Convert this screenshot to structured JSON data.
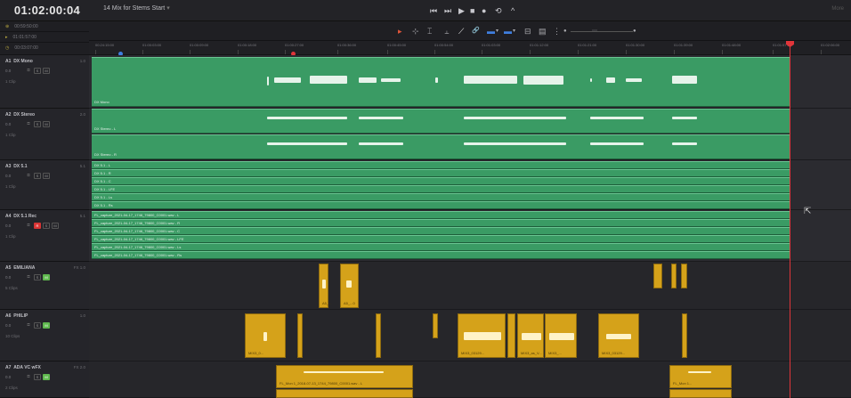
{
  "header": {
    "timecode": "01:02:00:04",
    "timeline_name": "14 Mix for Stems Start",
    "more_label": "More",
    "transport": [
      "⏮",
      "⏭",
      "▶",
      "■",
      "●",
      "⟲",
      "^"
    ],
    "info_rows": [
      {
        "glyph": "⊕",
        "value": "00:59:50:00"
      },
      {
        "glyph": "▸",
        "value": "01:01:57:00"
      },
      {
        "glyph": "◷",
        "value": "00:03:07:00"
      }
    ]
  },
  "toolbar": {
    "tools": [
      "▸",
      "⊹",
      "⌶",
      "⫠",
      "⟋",
      "🔗",
      "▬",
      "▾",
      "▬",
      "▾",
      "⊟",
      "▤",
      "⋮",
      "●",
      "⋯",
      "●"
    ]
  },
  "ruler": {
    "labels": [
      "00:24:15:00",
      "01:00:03:00",
      "01:00:09:00",
      "01:00:18:00",
      "01:00:27:00",
      "01:00:36:00",
      "01:00:45:00",
      "01:00:54:00",
      "01:01:03:00",
      "01:01:12:00",
      "01:01:21:00",
      "01:01:30:00",
      "01:01:39:00",
      "01:01:48:00",
      "01:01:57:00",
      "01:02:06:00"
    ]
  },
  "tracks": [
    {
      "id": "A1",
      "name": "DX Mono",
      "format": "1.0",
      "volume": "0.0",
      "clips": "1 Clip",
      "buttons": [
        "S",
        "M"
      ],
      "rec": false
    },
    {
      "id": "A2",
      "name": "DX Stereo",
      "format": "2.0",
      "volume": "0.0",
      "clips": "1 Clip",
      "buttons": [
        "S",
        "M"
      ],
      "rec": false
    },
    {
      "id": "A3",
      "name": "DX 5.1",
      "format": "5.1",
      "volume": "0.0",
      "clips": "1 Clip",
      "buttons": [
        "S",
        "M"
      ],
      "rec": false
    },
    {
      "id": "A4",
      "name": "DX 5.1 Rec",
      "format": "5.1",
      "volume": "0.0",
      "clips": "1 Clip",
      "buttons": [
        "R",
        "S",
        "M"
      ],
      "rec": true
    },
    {
      "id": "A5",
      "name": "EMILIANA",
      "format": "FX  1.0",
      "volume": "0.0",
      "clips": "5 Clips",
      "buttons": [
        "S",
        "M"
      ],
      "rec": false
    },
    {
      "id": "A6",
      "name": "PHILIP",
      "format": "1.0",
      "volume": "0.0",
      "clips": "10 Clips",
      "buttons": [
        "S",
        "M"
      ],
      "rec": false
    },
    {
      "id": "A7",
      "name": "ADA VC wFX",
      "format": "FX  2.0",
      "volume": "0.0",
      "clips": "2 Clips",
      "buttons": [
        "S",
        "M"
      ],
      "rec": false
    }
  ],
  "clip_labels": {
    "a1": "DX Mono",
    "a2_l": "DX Stereo - L",
    "a2_r": "DX Stereo - R",
    "a3": [
      "DX 5.1 - L",
      "DX 5.1 - R",
      "DX 5.1 - C",
      "DX 5.1 - LFE",
      "DX 5.1 - Ls",
      "DX 5.1 - Rs"
    ],
    "a4": [
      "FL_capture_2021-04-17_1746_79800_C0001.wav - L",
      "FL_capture_2021-04-17_1746_79800_C0001.wav - R",
      "FL_capture_2021-04-17_1746_79800_C0001.wav - C",
      "FL_capture_2021-04-17_1746_79800_C0001.wav - LFE",
      "FL_capture_2021-04-17_1746_79800_C0001.wav - Ls",
      "FL_capture_2021-04-17_1746_79800_C0001.wav - Rs"
    ],
    "a5": [
      "A5_...",
      "A5_...0"
    ],
    "a6": [
      "MIX3_0...",
      "MIX3_03129...",
      "MIX3_as_V...",
      "MIX3_...",
      "MIX3_03129..."
    ],
    "a7": [
      "FL_Mon 1_2018-07-13_1744_79800_C0001.wav - L",
      "FL_Mon 1..."
    ]
  },
  "colors": {
    "green_clip": "#3a9b64",
    "yellow_clip": "#d5a21a",
    "playhead": "#e0353a"
  }
}
